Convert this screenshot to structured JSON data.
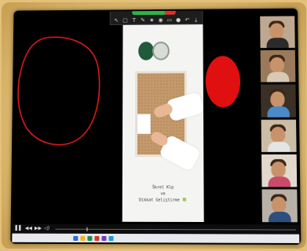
{
  "annotation_toolbar": {
    "tools": [
      {
        "icon": "mouse-icon",
        "glyph": "↖",
        "label": ""
      },
      {
        "icon": "select-icon",
        "glyph": "▢",
        "label": ""
      },
      {
        "icon": "text-icon",
        "glyph": "T",
        "label": ""
      },
      {
        "icon": "draw-icon",
        "glyph": "✎",
        "label": ""
      },
      {
        "icon": "stamp-icon",
        "glyph": "★",
        "label": ""
      },
      {
        "icon": "spotlight-icon",
        "glyph": "◉",
        "label": ""
      },
      {
        "icon": "eraser-icon",
        "glyph": "▭",
        "label": ""
      },
      {
        "icon": "format-icon",
        "glyph": "●",
        "label": ""
      },
      {
        "icon": "undo-icon",
        "glyph": "↶",
        "label": ""
      },
      {
        "icon": "save-icon",
        "glyph": "⤓",
        "label": ""
      }
    ]
  },
  "video": {
    "caption_line1": "Škrel Klp",
    "caption_line2": "ve",
    "caption_line3": "Dikkat Geliştirme 🍀"
  },
  "drawing": {
    "circle_color": "#e01b1b",
    "fill_color": "#e01010"
  },
  "participants": [
    {
      "bg": "#bfa891",
      "body": "#2b2b2b"
    },
    {
      "bg": "#9a7a5a",
      "body": "#d7c9b4"
    },
    {
      "bg": "#3a3026",
      "body": "#4a8ac9"
    },
    {
      "bg": "#cbbda6",
      "body": "#e4e4e4"
    },
    {
      "bg": "#e2d8cc",
      "body": "#c94a6a"
    },
    {
      "bg": "#b9b1a8",
      "body": "#2d4f7d"
    }
  ],
  "player": {
    "play": "▌▌",
    "prev": "◀◀",
    "next": "▶▶",
    "volume": "◁)"
  },
  "taskbar": {
    "icons": [
      "#2c6bd6",
      "#f3b51b",
      "#1f8a4c",
      "#d6372c",
      "#6c3fc4",
      "#1c9ad6"
    ]
  }
}
